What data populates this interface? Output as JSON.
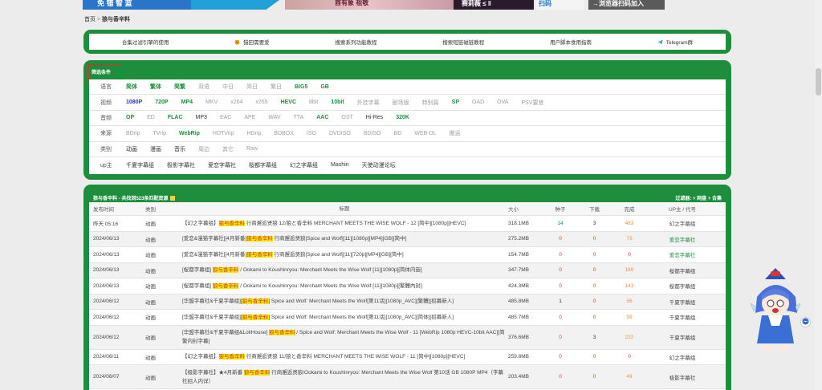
{
  "top_banner": {
    "left_text": "免 错 智 蓝",
    "mid_text": "酋有象 祖敬",
    "right_text": "赛莉薇 ≤ ‖",
    "browser_text": "→浏览器扫码加入",
    "qr_text": "扫码"
  },
  "breadcrumb": {
    "home": "首页",
    "sep": ">",
    "current": "狼与香辛料"
  },
  "nav": {
    "items": [
      {
        "label": "合集过滤引擎的使用",
        "icon": ""
      },
      {
        "label": "猫田需要爱",
        "icon": "cat-face-icon"
      },
      {
        "label": "搜索系列功能教程",
        "icon": ""
      },
      {
        "label": "搜索短链磁链教程",
        "icon": ""
      },
      {
        "label": "用户脚本食用指南",
        "icon": ""
      },
      {
        "label": "Telegram群",
        "icon": "telegram-icon"
      }
    ]
  },
  "filter": {
    "title": "筛选条件",
    "rows": [
      {
        "label": "语言",
        "options": [
          {
            "t": "简体",
            "s": "b"
          },
          {
            "t": "繁体",
            "s": "b"
          },
          {
            "t": "简繁",
            "s": "b"
          },
          {
            "t": "双语",
            "s": ""
          },
          {
            "t": "中日",
            "s": ""
          },
          {
            "t": "简日",
            "s": ""
          },
          {
            "t": "繁日",
            "s": ""
          },
          {
            "t": "BIG5",
            "s": "b"
          },
          {
            "t": "GB",
            "s": "b"
          }
        ]
      },
      {
        "label": "视频",
        "options": [
          {
            "t": "1080P",
            "s": "u"
          },
          {
            "t": "720P",
            "s": "b"
          },
          {
            "t": "MP4",
            "s": "b"
          },
          {
            "t": "MKV",
            "s": ""
          },
          {
            "t": "x264",
            "s": ""
          },
          {
            "t": "x265",
            "s": ""
          },
          {
            "t": "HEVC",
            "s": "b"
          },
          {
            "t": "8bit",
            "s": ""
          },
          {
            "t": "10bit",
            "s": "b"
          },
          {
            "t": "外挂字幕",
            "s": ""
          },
          {
            "t": "剧场版",
            "s": ""
          },
          {
            "t": "特别篇",
            "s": ""
          },
          {
            "t": "SP",
            "s": "b"
          },
          {
            "t": "OAD",
            "s": ""
          },
          {
            "t": "OVA",
            "s": ""
          },
          {
            "t": "PSV要官",
            "s": ""
          }
        ]
      },
      {
        "label": "音频",
        "options": [
          {
            "t": "OP",
            "s": "b"
          },
          {
            "t": "ED",
            "s": ""
          },
          {
            "t": "FLAC",
            "s": "b"
          },
          {
            "t": "MP3",
            "s": "d"
          },
          {
            "t": "EAC",
            "s": ""
          },
          {
            "t": "APE",
            "s": ""
          },
          {
            "t": "WAV",
            "s": ""
          },
          {
            "t": "TTA",
            "s": ""
          },
          {
            "t": "AAC",
            "s": "b"
          },
          {
            "t": "OST",
            "s": ""
          },
          {
            "t": "Hi-Res",
            "s": "d"
          },
          {
            "t": "320K",
            "s": "b"
          }
        ]
      },
      {
        "label": "来源",
        "options": [
          {
            "t": "BDrip",
            "s": ""
          },
          {
            "t": "TVrip",
            "s": ""
          },
          {
            "t": "WebRip",
            "s": "b"
          },
          {
            "t": "HDTVrip",
            "s": ""
          },
          {
            "t": "HDrip",
            "s": ""
          },
          {
            "t": "BDBOX",
            "s": ""
          },
          {
            "t": "ISO",
            "s": ""
          },
          {
            "t": "DVDISO",
            "s": ""
          },
          {
            "t": "BDISO",
            "s": ""
          },
          {
            "t": "BD",
            "s": ""
          },
          {
            "t": "WEB-DL",
            "s": ""
          },
          {
            "t": "搬运",
            "s": ""
          }
        ]
      },
      {
        "label": "类别",
        "options": [
          {
            "t": "动画",
            "s": "d"
          },
          {
            "t": "漫画",
            "s": "d"
          },
          {
            "t": "音乐",
            "s": "d"
          },
          {
            "t": "周边",
            "s": ""
          },
          {
            "t": "其它",
            "s": ""
          },
          {
            "t": "Raw",
            "s": ""
          }
        ]
      },
      {
        "label": "up主",
        "options": [
          {
            "t": "千夏字幕组",
            "s": "d"
          },
          {
            "t": "极影字幕社",
            "s": "d"
          },
          {
            "t": "爱恋字幕社",
            "s": "d"
          },
          {
            "t": "桜都字幕组",
            "s": "d"
          },
          {
            "t": "幻之字幕组",
            "s": "d"
          },
          {
            "t": "Mashin",
            "s": "d"
          },
          {
            "t": "天使动漫论坛",
            "s": "d"
          }
        ]
      }
    ]
  },
  "list": {
    "title": "狼与香辛料 - 共找到523条匹配资源",
    "actions": "过滤器: + 网盘 + 合集",
    "headers": {
      "time": "发布时间",
      "cat": "类别",
      "title": "标题",
      "size": "大小",
      "seed": "种子",
      "dl": "下载",
      "done": "完成",
      "up": "UP主 / 代号"
    },
    "rows": [
      {
        "time": "昨天 05:16",
        "cat": "动画",
        "pre": "【幻之字幕组】",
        "hl": "狼与香辛料",
        "post": " 行商邂逅贤狼 12/狼と香辛料 MERCHANT MEETS THE WISE WOLF - 12 [简中][1080p][HEVC]",
        "size": "318.1MB",
        "seed": "14",
        "seedc": "seed-g",
        "dl": "3",
        "dlc": "dl-k",
        "done": "483",
        "donec": "done-o",
        "up": "幻之字幕组",
        "upc": "up-k",
        "tall": false
      },
      {
        "time": "2024/06/13",
        "cat": "动画",
        "pre": "[爱恋&漫猫字幕社][4月新番]",
        "hl": "狼与香辛料",
        "post": " 行商邂逅贤狼[Spice and Wolf][11][1080p][MP4][GB][简中]",
        "size": "275.2MB",
        "seed": "0",
        "seedc": "seed-r",
        "dl": "0",
        "dlc": "dl-r",
        "done": "73",
        "donec": "done-o",
        "up": "爱恋字幕社",
        "upc": "up-g",
        "tall": false
      },
      {
        "time": "2024/06/13",
        "cat": "动画",
        "pre": "[爱恋&漫猫字幕社][4月新番]",
        "hl": "狼与香辛料",
        "post": " 行商邂逅贤狼[Spice and Wolf][11][720p][MP4][GB][简中]",
        "size": "154.7MB",
        "seed": "0",
        "seedc": "seed-r",
        "dl": "0",
        "dlc": "dl-r",
        "done": "0",
        "donec": "done-r",
        "up": "爱恋字幕社",
        "upc": "up-g",
        "tall": false
      },
      {
        "time": "2024/06/13",
        "cat": "动画",
        "pre": "[桜都字幕组] ",
        "hl": "狼与香辛料",
        "post": " / Ookami to Koushinryou: Merchant Meets the Wise Wolf [11][1080p][简体内嵌]",
        "size": "347.7MB",
        "seed": "0",
        "seedc": "seed-r",
        "dl": "0",
        "dlc": "dl-r",
        "done": "169",
        "donec": "done-o",
        "up": "桜都字幕组",
        "upc": "up-k",
        "tall": false
      },
      {
        "time": "2024/06/13",
        "cat": "动画",
        "pre": "[桜都字幕组] ",
        "hl": "狼与香辛料",
        "post": " / Ookami to Koushinryou: Merchant Meets the Wise Wolf [11][1080p][繁體內封]",
        "size": "424.3MB",
        "seed": "0",
        "seedc": "seed-r",
        "dl": "0",
        "dlc": "dl-r",
        "done": "143",
        "donec": "done-o",
        "up": "桜都字幕组",
        "upc": "up-k",
        "tall": false
      },
      {
        "time": "2024/06/12",
        "cat": "动画",
        "pre": "[华盟字幕社&千夏字幕组]",
        "hl": "[狼与香辛料]",
        "post": " Spice and Wolf: Merchant Meets the Wolf[第11话][1080p_AVC][繁體][招募新人]",
        "size": "485.8MB",
        "seed": "1",
        "seedc": "seed-k",
        "dl": "0",
        "dlc": "dl-r",
        "done": "56",
        "donec": "done-o",
        "up": "千夏字幕组",
        "upc": "up-k",
        "tall": false
      },
      {
        "time": "2024/06/12",
        "cat": "动画",
        "pre": "[华盟字幕社&千夏字幕组]",
        "hl": "[狼与香辛料]",
        "post": " Spice and Wolf: Merchant Meets the Wolf[第11话][1080p_AVC][简体][招募新人]",
        "size": "485.7MB",
        "seed": "0",
        "seedc": "seed-r",
        "dl": "0",
        "dlc": "dl-r",
        "done": "59",
        "donec": "done-o",
        "up": "千夏字幕组",
        "upc": "up-k",
        "tall": false
      },
      {
        "time": "2024/06/12",
        "cat": "动画",
        "pre": "[华盟字幕社&千夏字幕组&LoliHouse] ",
        "hl": "狼与香辛料",
        "post": " / Spice and Wolf: Merchant Meets the Wise Wolf - 11 [WebRip 1080p HEVC-10bit AAC][简繁内封字幕]",
        "size": "376.6MB",
        "seed": "0",
        "seedc": "seed-r",
        "dl": "3",
        "dlc": "dl-k",
        "done": "222",
        "donec": "done-o",
        "up": "千夏字幕组",
        "upc": "up-k",
        "tall": true
      },
      {
        "time": "2024/06/11",
        "cat": "动画",
        "pre": "【幻之字幕组】",
        "hl": "狼与香辛料",
        "post": " 行商邂逅贤狼 11/狼と香辛料 MERCHANT MEETS THE WISE WOLF - 11 [简中][1080p][HEVC]",
        "size": "259.8MB",
        "seed": "0",
        "seedc": "seed-r",
        "dl": "0",
        "dlc": "dl-r",
        "done": "0",
        "donec": "done-r",
        "up": "幻之字幕组",
        "upc": "up-k",
        "tall": false
      },
      {
        "time": "2024/06/07",
        "cat": "动画",
        "pre": "【极影字幕社】★4月新番 ",
        "hl": "狼与香辛料",
        "post": " 行商邂逅贤狼/Ookami to Koushinryou: Merchant Meets the Wise Wolf 第10话 GB 1080P MP4（字幕社招人内详）",
        "size": "203.4MB",
        "seed": "0",
        "seedc": "seed-r",
        "dl": "0",
        "dlc": "dl-r",
        "done": "49",
        "donec": "done-o",
        "up": "极影字幕社",
        "upc": "up-k",
        "tall": true
      }
    ]
  },
  "colors": {
    "brand_green": "#1e8e3e",
    "highlight": "#ffe600",
    "red": "#e53935",
    "orange": "#f0903c",
    "blue": "#2b32c8"
  }
}
